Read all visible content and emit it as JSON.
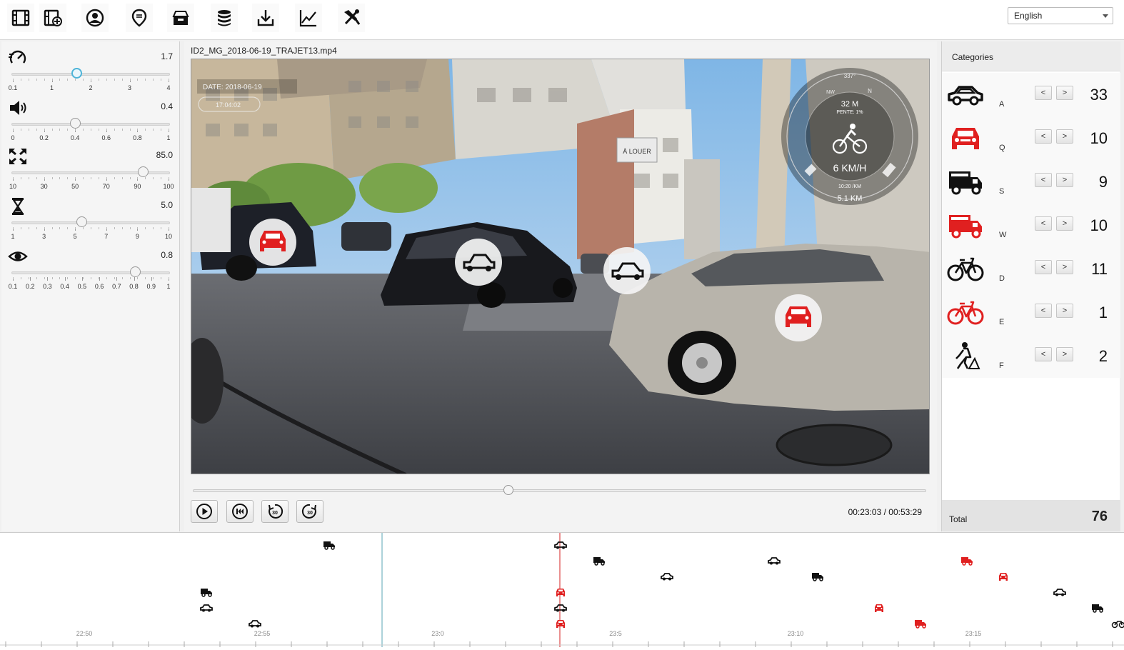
{
  "toolbar": {
    "buttons": [
      {
        "name": "film-icon"
      },
      {
        "name": "film-add-icon"
      },
      {
        "name": "user-circle-icon"
      },
      {
        "name": "map-pin-icon"
      },
      {
        "name": "archive-box-icon"
      },
      {
        "name": "database-icon"
      },
      {
        "name": "download-icon"
      },
      {
        "name": "line-chart-icon"
      },
      {
        "name": "tools-icon"
      }
    ],
    "language": "English"
  },
  "controls": [
    {
      "name": "speed",
      "icon": "speed-dial-icon",
      "value": "1.7",
      "ticks": [
        "0.1",
        "1",
        "2",
        "3",
        "4"
      ],
      "fraction": 0.41,
      "active": true
    },
    {
      "name": "volume",
      "icon": "speaker-icon",
      "value": "0.4",
      "ticks": [
        "0",
        "0.2",
        "0.4",
        "0.6",
        "0.8",
        "1"
      ],
      "fraction": 0.4,
      "active": false
    },
    {
      "name": "zoom",
      "icon": "expand-icon",
      "value": "85.0",
      "ticks": [
        "10",
        "30",
        "50",
        "70",
        "90",
        "100"
      ],
      "fraction": 0.83,
      "active": false
    },
    {
      "name": "duration",
      "icon": "hourglass-icon",
      "value": "5.0",
      "ticks": [
        "1",
        "3",
        "5",
        "7",
        "9",
        "10"
      ],
      "fraction": 0.44,
      "active": false
    },
    {
      "name": "visibility",
      "icon": "eye-icon",
      "value": "0.8",
      "ticks": [
        "0.1",
        "0.2",
        "0.3",
        "0.4",
        "0.5",
        "0.6",
        "0.7",
        "0.8",
        "0.9",
        "1"
      ],
      "fraction": 0.78,
      "active": false
    }
  ],
  "video": {
    "filename": "ID2_MG_2018-06-19_TRAJET13.mp4",
    "overlay_date": "DATE: 2018-06-19",
    "overlay_time": "17:04:02",
    "hud": {
      "heading": "337°",
      "compass_nw": "NW",
      "compass_n": "N",
      "altitude": "32 M",
      "slope": "PENTE: 1%",
      "speed": "6 KM/H",
      "pace": "10:20 /KM",
      "distance": "5.1 KM"
    },
    "sign_text": "À LOUER",
    "position": 0.43,
    "time": "00:23:03 / 00:53:29"
  },
  "player_buttons": [
    {
      "name": "play-icon"
    },
    {
      "name": "skip-start-icon"
    },
    {
      "name": "rewind-30-icon",
      "text": "30"
    },
    {
      "name": "forward-30-icon",
      "text": "30"
    }
  ],
  "categories": {
    "title": "Categories",
    "items": [
      {
        "key": "A",
        "count": "33",
        "icon": "car-icon",
        "color": "#111111"
      },
      {
        "key": "Q",
        "count": "10",
        "icon": "car-front-icon",
        "color": "#e02020"
      },
      {
        "key": "S",
        "count": "9",
        "icon": "truck-icon",
        "color": "#111111"
      },
      {
        "key": "W",
        "count": "10",
        "icon": "truck-icon",
        "color": "#e02020"
      },
      {
        "key": "D",
        "count": "11",
        "icon": "bicycle-icon",
        "color": "#111111"
      },
      {
        "key": "E",
        "count": "1",
        "icon": "bicycle-icon",
        "color": "#e02020"
      },
      {
        "key": "F",
        "count": "2",
        "icon": "pedestrian-icon",
        "color": "#111111"
      }
    ],
    "prev_label": "<",
    "next_label": ">",
    "total_label": "Total",
    "total": "76"
  },
  "timeline": {
    "labels": [
      "22:50",
      "22:55",
      "23:0",
      "23:5",
      "23:10",
      "23:15"
    ]
  }
}
